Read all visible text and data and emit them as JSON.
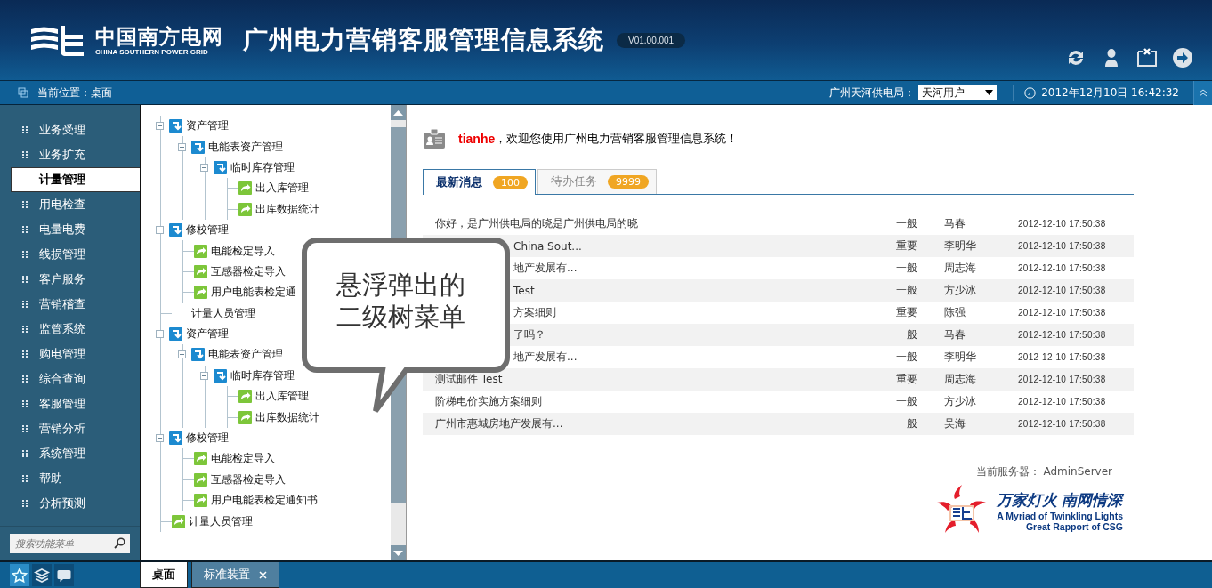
{
  "header": {
    "brand_cn": "中国南方电网",
    "brand_en": "CHINA SOUTHERN POWER GRID",
    "title": "广州电力营销客服管理信息系统",
    "version": "V01.00.001"
  },
  "location_bar": {
    "breadcrumb": "当前位置：桌面",
    "bureau_label": "广州天河供电局：",
    "bureau_value": "天河用户",
    "datetime": "2012年12月10日 16:42:32"
  },
  "sidebar": {
    "items": [
      {
        "label": "业务受理",
        "selected": false
      },
      {
        "label": "业务扩充",
        "selected": false
      },
      {
        "label": "计量管理",
        "selected": true
      },
      {
        "label": "用电检查",
        "selected": false
      },
      {
        "label": "电量电费",
        "selected": false
      },
      {
        "label": "线损管理",
        "selected": false
      },
      {
        "label": "客户服务",
        "selected": false
      },
      {
        "label": "营销稽查",
        "selected": false
      },
      {
        "label": "监管系统",
        "selected": false
      },
      {
        "label": "购电管理",
        "selected": false
      },
      {
        "label": "综合查询",
        "selected": false
      },
      {
        "label": "客服管理",
        "selected": false
      },
      {
        "label": "营销分析",
        "selected": false
      },
      {
        "label": "系统管理",
        "selected": false
      },
      {
        "label": "帮助",
        "selected": false
      },
      {
        "label": "分析预测",
        "selected": false
      }
    ],
    "search": {
      "placeholder": "搜索功能菜单"
    },
    "dock": [
      {
        "kind": "star",
        "selected": true
      },
      {
        "kind": "layers",
        "selected": false
      },
      {
        "kind": "chat",
        "selected": false
      }
    ]
  },
  "tree": [
    {
      "label": "资产管理",
      "kind": "folder",
      "expanded": true,
      "children": [
        {
          "label": "电能表资产管理",
          "kind": "folder",
          "expanded": true,
          "children": [
            {
              "label": "临时库存管理",
              "kind": "folder",
              "expanded": true,
              "children": [
                {
                  "label": "出入库管理",
                  "kind": "page"
                },
                {
                  "label": "出库数据统计",
                  "kind": "page"
                }
              ]
            }
          ]
        }
      ]
    },
    {
      "label": "修校管理",
      "kind": "folder",
      "expanded": true,
      "children": [
        {
          "label": "电能检定导入",
          "kind": "page"
        },
        {
          "label": "互感器检定导入",
          "kind": "page"
        },
        {
          "label": "用户电能表检定通",
          "kind": "page"
        }
      ]
    },
    {
      "label": "计量人员管理",
      "kind": "plain"
    },
    {
      "label": "资产管理",
      "kind": "folder",
      "expanded": true,
      "children": [
        {
          "label": "电能表资产管理",
          "kind": "folder",
          "expanded": true,
          "children": [
            {
              "label": "临时库存管理",
              "kind": "folder",
              "expanded": true,
              "children": [
                {
                  "label": "出入库管理",
                  "kind": "page"
                },
                {
                  "label": "出库数据统计",
                  "kind": "page"
                }
              ]
            }
          ]
        }
      ]
    },
    {
      "label": "修校管理",
      "kind": "folder",
      "expanded": true,
      "children": [
        {
          "label": "电能检定导入",
          "kind": "page"
        },
        {
          "label": "互感器检定导入",
          "kind": "page"
        },
        {
          "label": "用户电能表检定通知书",
          "kind": "page"
        }
      ]
    },
    {
      "label": "计量人员管理",
      "kind": "page"
    }
  ],
  "callout": {
    "lines": [
      "悬浮弹出的",
      "二级树菜单"
    ]
  },
  "welcome": {
    "user": "tianhe",
    "text": "，欢迎您使用广州电力营销客服管理信息系统！"
  },
  "message_tabs": [
    {
      "label": "最新消息",
      "count": "100",
      "selected": true
    },
    {
      "label": "待办任务",
      "count": "9999",
      "selected": false
    }
  ],
  "messages": [
    {
      "title": "你好，是广州供电局的晓是广州供电局的晓",
      "level": "一般",
      "person": "马春",
      "time": "2012-12-10 17:50:38"
    },
    {
      "title_tail": "China Sout...",
      "level": "重要",
      "person": "李明华",
      "time": "2012-12-10 17:50:38"
    },
    {
      "title_tail": "地产发展有...",
      "level": "一般",
      "person": "周志海",
      "time": "2012-12-10 17:50:38"
    },
    {
      "title_tail": "Test",
      "level": "一般",
      "person": "方少冰",
      "time": "2012-12-10 17:50:38"
    },
    {
      "title_tail": "方案细则",
      "level": "重要",
      "person": "陈强",
      "time": "2012-12-10 17:50:38"
    },
    {
      "title_tail": "了吗？",
      "level": "一般",
      "person": "马春",
      "time": "2012-12-10 17:50:38"
    },
    {
      "title_tail": "地产发展有...",
      "level": "一般",
      "person": "李明华",
      "time": "2012-12-10 17:50:38"
    },
    {
      "title": "测试邮件 Test",
      "level": "重要",
      "person": "周志海",
      "time": "2012-12-10 17:50:38"
    },
    {
      "title": "阶梯电价实施方案细则",
      "level": "一般",
      "person": "方少冰",
      "time": "2012-12-10 17:50:38"
    },
    {
      "title": "广州市惠城房地产发展有...",
      "level": "一般",
      "person": "吴海",
      "time": "2012-12-10 17:50:38"
    }
  ],
  "server": "当前服务器：  AdminServer",
  "slogan": {
    "cn": "万家灯火 南网情深",
    "en1": "A Myriad of Twinkling Lights",
    "en2": "Great Rapport of CSG"
  },
  "bottom_tabs": [
    {
      "label": "桌面",
      "selected": true,
      "closable": false
    },
    {
      "label": "标准装置",
      "selected": false,
      "closable": true
    }
  ]
}
